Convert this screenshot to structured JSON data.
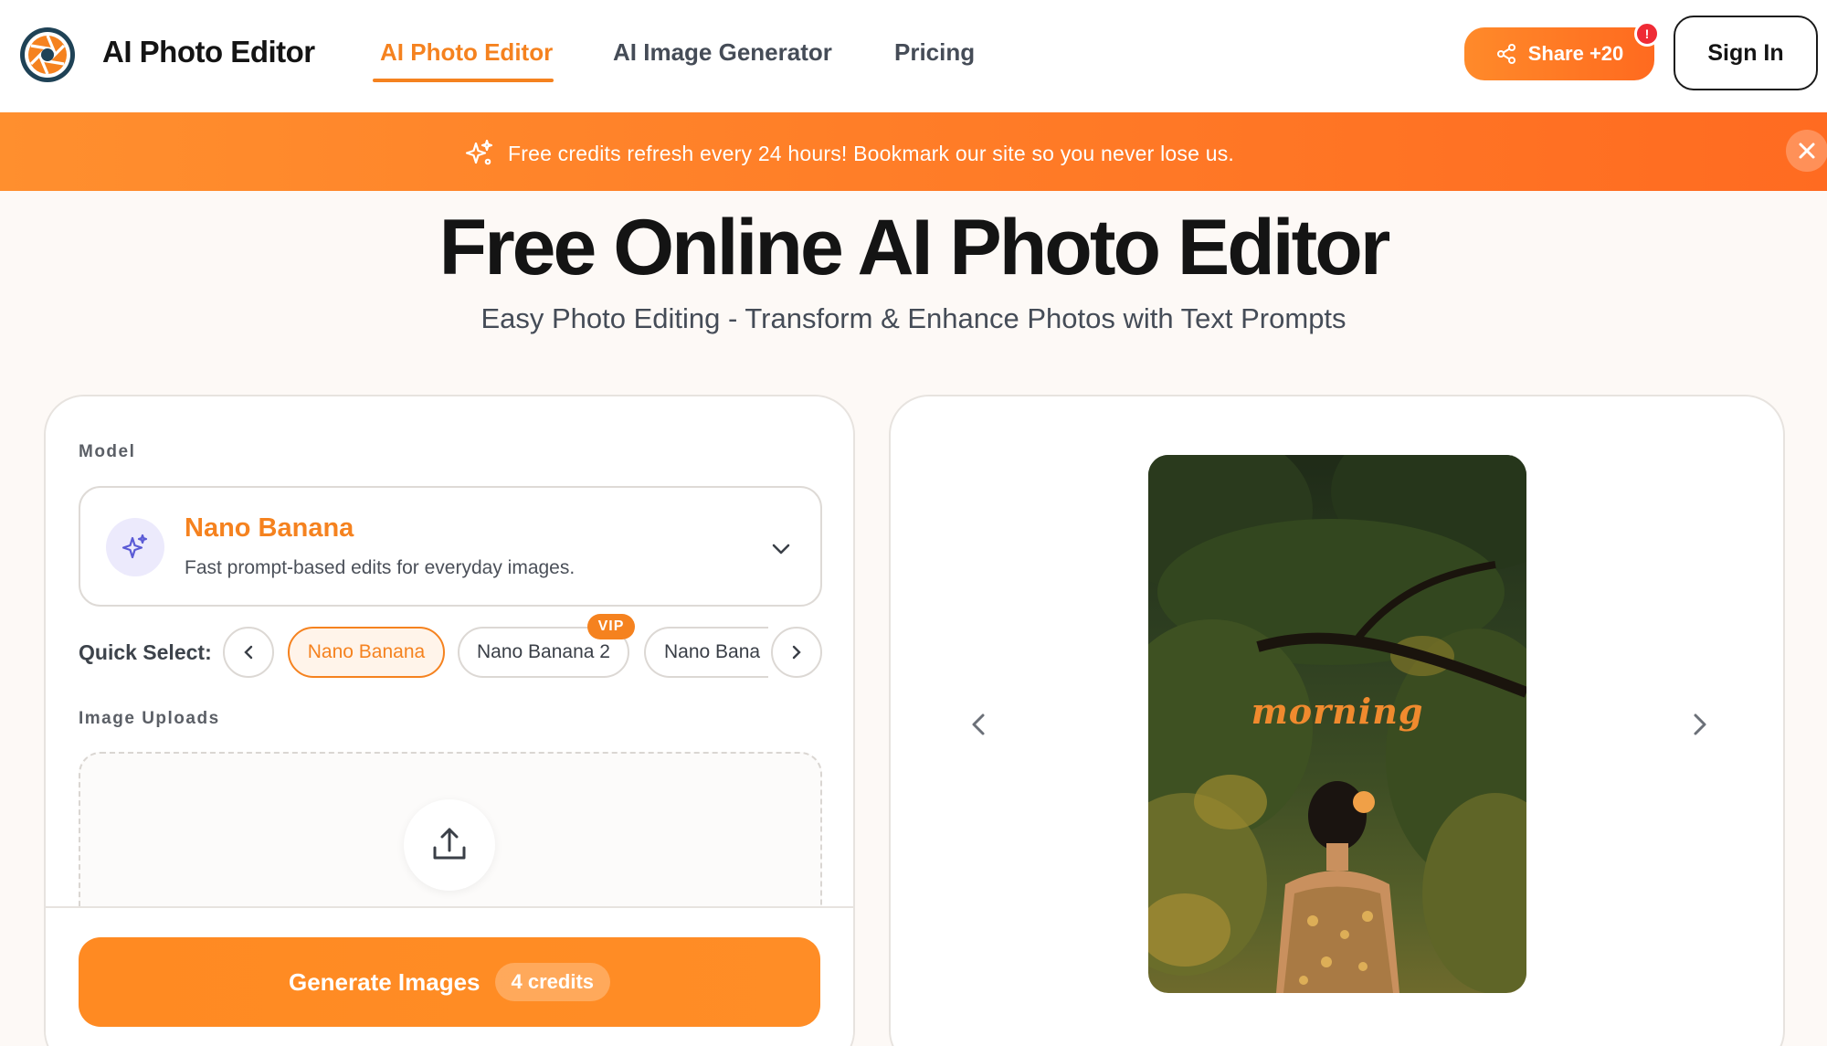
{
  "header": {
    "brand": "AI Photo Editor",
    "nav": [
      "AI Photo Editor",
      "AI Image Generator",
      "Pricing"
    ],
    "active_nav": "AI Photo Editor",
    "share_label": "Share +20",
    "share_badge": "!",
    "signin_label": "Sign In"
  },
  "banner": {
    "text": "Free credits refresh every 24 hours! Bookmark our site so you never lose us.",
    "close_icon": "close-icon"
  },
  "hero": {
    "title": "Free Online AI Photo Editor",
    "subtitle": "Easy Photo Editing - Transform & Enhance Photos with Text Prompts"
  },
  "editor": {
    "model_label": "Model",
    "model_name": "Nano Banana",
    "model_desc": "Fast prompt-based edits for everyday images.",
    "quick_select_label": "Quick Select:",
    "chips": [
      "Nano Banana",
      "Nano Banana 2",
      "Nano Bana"
    ],
    "active_chip": "Nano Banana",
    "vip_badge": "VIP",
    "uploads_label": "Image Uploads",
    "generate_label": "Generate Images",
    "credits_label": "4 credits"
  },
  "preview": {
    "overlay_text": "morning"
  },
  "colors": {
    "accent": "#f5821f",
    "banner": "#ff7a26",
    "text_dark": "#141414",
    "badge_red": "#ef2b35"
  }
}
